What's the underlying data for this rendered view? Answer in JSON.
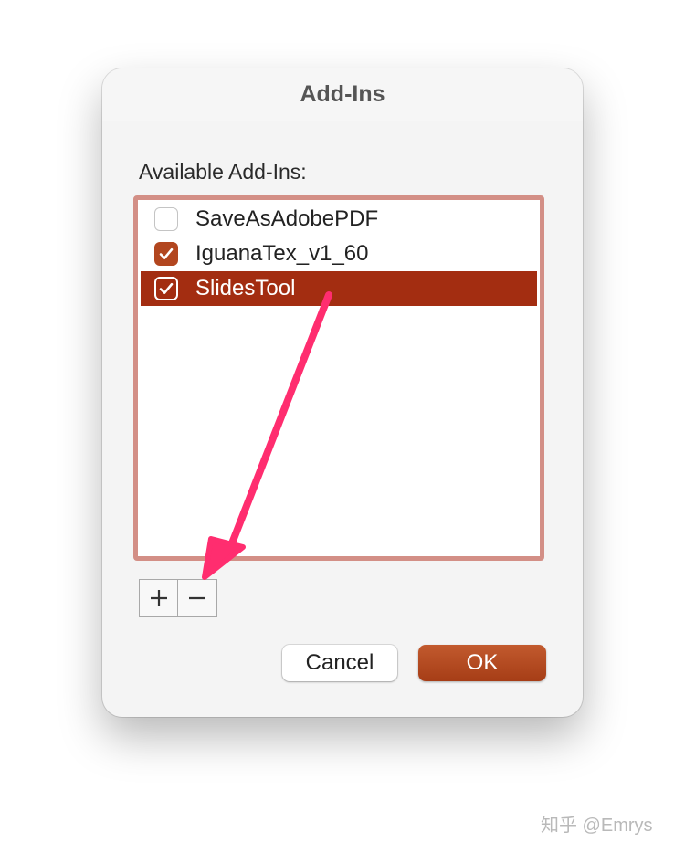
{
  "dialog": {
    "title": "Add-Ins",
    "section_label": "Available Add-Ins:",
    "addins": [
      {
        "label": "SaveAsAdobePDF",
        "checked": false,
        "selected": false
      },
      {
        "label": "IguanaTex_v1_60",
        "checked": true,
        "selected": false
      },
      {
        "label": "SlidesTool",
        "checked": true,
        "selected": true
      }
    ],
    "add_label": "+",
    "remove_label": "−",
    "cancel_label": "Cancel",
    "ok_label": "OK"
  },
  "watermark": "知乎 @Emrys",
  "colors": {
    "accent": "#a32d11",
    "checkbox_checked": "#b2461f",
    "list_border": "#d38f86",
    "annotation_arrow": "#ff2d6f"
  },
  "icons": {
    "checkmark": "checkmark-icon",
    "add": "plus-icon",
    "remove": "minus-icon"
  }
}
